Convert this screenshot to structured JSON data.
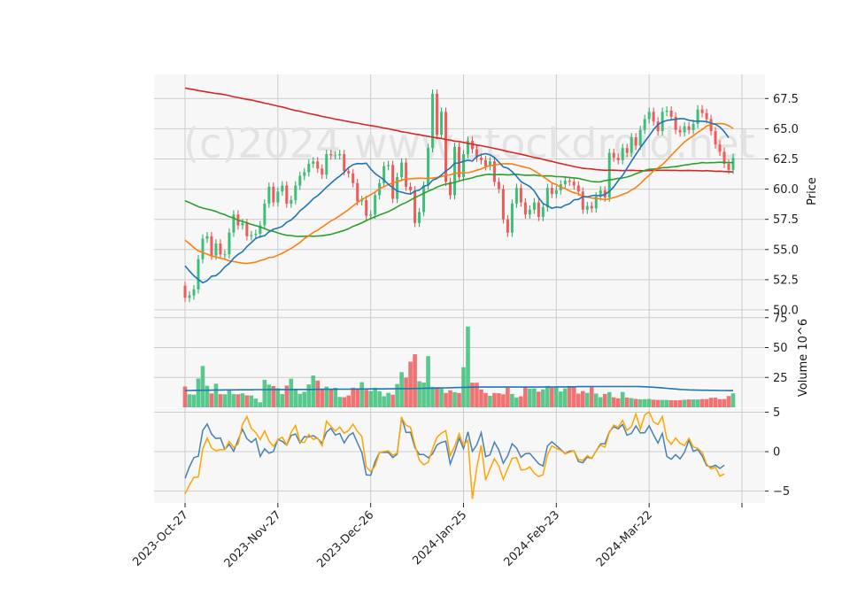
{
  "chart_data": {
    "type": "candlestick",
    "watermark": "(c)2024 www.stockdroid.net",
    "colors": {
      "up": "#26a65b",
      "down": "#e84848",
      "up_fill": "#3cbf7a",
      "down_fill": "#f05a5a",
      "ma_short": "#1f77b4",
      "ma_mid": "#ff7f0e",
      "ma_long": "#2ca02c",
      "ma_200": "#d62728",
      "vol_avg": "#1f77b4",
      "osc_1": "#4682b4",
      "osc_2": "#ffa500",
      "panel_bg": "#f7f7f7",
      "grid": "#cccccc"
    },
    "x_tick_labels": [
      "2023-Oct-27",
      "2023-Nov-27",
      "2023-Dec-26",
      "2024-Jan-25",
      "2024-Feb-23",
      "2024-Mar-22"
    ],
    "x_tick_index": [
      0,
      21,
      42,
      63,
      84,
      105
    ],
    "price_panel": {
      "ylabel": "Price",
      "ylim": [
        50.0,
        69.5
      ],
      "yticks": [
        "50.0",
        "52.5",
        "55.0",
        "57.5",
        "60.0",
        "62.5",
        "65.0",
        "67.5"
      ],
      "ytick_values": [
        50.0,
        52.5,
        55.0,
        57.5,
        60.0,
        62.5,
        65.0,
        67.5
      ],
      "close": [
        51.0,
        51.2,
        51.7,
        54.2,
        55.9,
        56.1,
        54.5,
        55.5,
        54.6,
        54.6,
        56.4,
        57.9,
        57.0,
        57.2,
        56.1,
        56.2,
        56.3,
        57.0,
        58.8,
        60.2,
        58.9,
        59.8,
        60.3,
        58.8,
        59.1,
        60.3,
        61.1,
        61.4,
        62.1,
        62.3,
        61.7,
        61.2,
        62.9,
        62.8,
        62.8,
        62.9,
        61.5,
        61.3,
        60.5,
        59.0,
        59.1,
        57.8,
        57.9,
        59.5,
        60.5,
        61.9,
        62.0,
        59.2,
        61.0,
        62.2,
        60.2,
        59.9,
        57.2,
        58.1,
        60.3,
        63.4,
        67.9,
        64.5,
        66.4,
        60.6,
        59.5,
        63.5,
        61.0,
        62.9,
        64.0,
        63.3,
        62.6,
        62.4,
        61.9,
        62.3,
        60.6,
        60.0,
        57.5,
        56.4,
        58.8,
        60.1,
        58.9,
        57.9,
        58.3,
        58.9,
        57.7,
        58.5,
        60.1,
        59.6,
        59.9,
        60.4,
        60.7,
        60.6,
        60.3,
        59.8,
        58.3,
        58.6,
        58.4,
        59.4,
        59.9,
        59.3,
        63.0,
        62.6,
        62.4,
        63.4,
        63.0,
        64.3,
        63.6,
        64.9,
        65.8,
        66.4,
        65.6,
        64.8,
        66.4,
        66.5,
        66.0,
        64.9,
        64.7,
        65.2,
        64.9,
        65.4,
        66.6,
        66.3,
        65.8,
        64.8,
        63.7,
        63.1,
        62.1,
        61.6,
        62.6
      ],
      "ma_short": [
        53.65,
        53.22,
        52.82,
        52.52,
        52.25,
        52.42,
        52.79,
        52.84,
        53.14,
        53.56,
        53.85,
        54.28,
        54.6,
        54.82,
        55.25,
        55.57,
        55.92,
        56.06,
        56.14,
        56.46,
        56.68,
        56.78,
        56.91,
        57.26,
        57.44,
        57.78,
        58.2,
        58.5,
        58.83,
        59.21,
        59.46,
        59.8,
        60.16,
        60.48,
        60.81,
        61.08,
        61.39,
        61.79,
        62.02,
        62.12,
        62.1,
        62.15,
        61.67,
        61.29,
        61.03,
        60.77,
        60.4,
        60.12,
        59.84,
        59.75,
        59.65,
        59.59,
        59.83,
        59.91,
        60.24,
        60.34,
        60.73,
        60.88,
        61.16,
        61.5,
        61.76,
        62.14,
        62.17,
        62.3,
        62.39,
        62.32,
        62.7,
        62.86,
        62.94,
        62.84,
        62.62,
        62.24,
        61.84,
        61.74,
        61.45,
        61.06,
        60.62,
        60.42,
        60.21,
        59.85,
        59.27,
        58.81,
        58.63,
        58.41,
        58.52,
        58.46,
        58.67,
        58.78,
        59.12,
        59.15,
        59.39,
        59.35,
        59.46,
        59.49,
        59.43,
        59.57,
        59.81,
        60.18,
        60.7,
        61.13,
        61.74,
        62.31,
        62.88,
        63.43,
        63.93,
        64.41,
        64.93,
        65.34,
        65.56,
        65.69,
        65.74,
        65.78,
        65.84,
        65.82,
        65.7,
        65.64,
        65.63,
        65.62,
        65.59,
        65.46,
        65.37,
        65.14,
        64.76,
        64.26
      ],
      "ma_mid": [
        55.77,
        55.49,
        55.16,
        54.89,
        54.75,
        54.62,
        54.46,
        54.39,
        54.28,
        54.2,
        54.07,
        54.0,
        53.94,
        53.87,
        53.84,
        53.9,
        53.95,
        54.09,
        54.18,
        54.34,
        54.37,
        54.53,
        54.69,
        54.89,
        55.09,
        55.34,
        55.58,
        55.91,
        56.15,
        56.41,
        56.6,
        56.86,
        57.1,
        57.37,
        57.56,
        57.8,
        58.05,
        58.31,
        58.61,
        58.9,
        59.12,
        59.35,
        59.54,
        59.76,
        60.04,
        60.2,
        60.38,
        60.51,
        60.63,
        60.75,
        60.85,
        60.86,
        60.88,
        60.91,
        60.89,
        60.88,
        60.91,
        60.97,
        61.03,
        61.16,
        61.18,
        61.31,
        61.33,
        61.35,
        61.36,
        61.44,
        61.57,
        61.66,
        61.84,
        61.96,
        61.97,
        62.06,
        62.1,
        62.11,
        62.08,
        61.99,
        61.9,
        61.8,
        61.72,
        61.52,
        61.28,
        61.03,
        60.8,
        60.52,
        60.38,
        60.16,
        60.05,
        59.85,
        59.7,
        59.61,
        59.4,
        59.37,
        59.26,
        59.23,
        59.19,
        59.12,
        59.2,
        59.3,
        59.41,
        59.57,
        59.69,
        59.93,
        60.14,
        60.46,
        60.83,
        61.15,
        61.5,
        61.75,
        62.03,
        62.4,
        62.79,
        63.17,
        63.55,
        63.91,
        64.18,
        64.43,
        64.7,
        64.93,
        65.21,
        65.36,
        65.41,
        65.43,
        65.4,
        65.25,
        65.03
      ],
      "ma_long": [
        59.04,
        58.89,
        58.72,
        58.55,
        58.43,
        58.35,
        58.26,
        58.15,
        58.0,
        57.89,
        57.71,
        57.62,
        57.42,
        57.33,
        57.21,
        57.08,
        56.98,
        56.86,
        56.74,
        56.59,
        56.5,
        56.38,
        56.27,
        56.18,
        56.16,
        56.1,
        56.09,
        56.1,
        56.12,
        56.1,
        56.12,
        56.14,
        56.2,
        56.25,
        56.36,
        56.47,
        56.58,
        56.72,
        56.92,
        57.06,
        57.21,
        57.4,
        57.57,
        57.72,
        57.86,
        58.0,
        58.14,
        58.31,
        58.53,
        58.74,
        58.89,
        59.1,
        59.3,
        59.47,
        59.65,
        59.83,
        59.98,
        60.17,
        60.31,
        60.42,
        60.47,
        60.56,
        60.67,
        60.78,
        60.85,
        60.93,
        61.06,
        61.12,
        61.2,
        61.23,
        61.19,
        61.21,
        61.2,
        61.17,
        61.2,
        61.23,
        61.19,
        61.15,
        61.15,
        61.17,
        61.11,
        61.09,
        61.1,
        61.09,
        61.03,
        61.03,
        61.0,
        60.96,
        60.93,
        60.89,
        60.8,
        60.71,
        60.63,
        60.6,
        60.61,
        60.71,
        60.76,
        60.82,
        60.89,
        60.92,
        61.0,
        61.11,
        61.28,
        61.41,
        61.55,
        61.64,
        61.66,
        61.71,
        61.77,
        61.79,
        61.83,
        61.86,
        61.93,
        61.99,
        62.04,
        62.1,
        62.13,
        62.2,
        62.17,
        62.19,
        62.2,
        62.23,
        62.21,
        62.19,
        62.2
      ],
      "ma_200": [
        68.37,
        68.3,
        68.24,
        68.16,
        68.1,
        68.04,
        67.98,
        67.92,
        67.88,
        67.82,
        67.74,
        67.64,
        67.59,
        67.5,
        67.43,
        67.38,
        67.29,
        67.21,
        67.12,
        67.05,
        66.96,
        66.87,
        66.8,
        66.7,
        66.6,
        66.51,
        66.45,
        66.35,
        66.27,
        66.19,
        66.11,
        66.02,
        65.95,
        65.88,
        65.79,
        65.73,
        65.66,
        65.59,
        65.52,
        65.47,
        65.39,
        65.32,
        65.26,
        65.2,
        65.14,
        65.06,
        65.0,
        64.91,
        64.85,
        64.75,
        64.7,
        64.63,
        64.56,
        64.51,
        64.43,
        64.37,
        64.3,
        64.24,
        64.2,
        64.11,
        64.06,
        63.97,
        63.94,
        63.87,
        63.79,
        63.74,
        63.65,
        63.6,
        63.52,
        63.45,
        63.37,
        63.3,
        63.21,
        63.11,
        63.04,
        62.97,
        62.89,
        62.81,
        62.71,
        62.62,
        62.55,
        62.46,
        62.37,
        62.3,
        62.2,
        62.12,
        62.03,
        61.96,
        61.87,
        61.8,
        61.72,
        61.69,
        61.67,
        61.61,
        61.59,
        61.56,
        61.57,
        61.57,
        61.55,
        61.53,
        61.55,
        61.56,
        61.54,
        61.53,
        61.52,
        61.54,
        61.54,
        61.56,
        61.56,
        61.56,
        61.55,
        61.55,
        61.53,
        61.54,
        61.55,
        61.53,
        61.53,
        61.5,
        61.53,
        61.5,
        61.48,
        61.49,
        61.46,
        61.44,
        61.42
      ]
    },
    "volume_panel": {
      "ylabel": "Volume  10^6",
      "ylim": [
        0,
        80
      ],
      "yticks": [
        "25",
        "50",
        "75"
      ],
      "ytick_values": [
        25,
        50,
        75
      ],
      "volume": [
        17.4,
        10.9,
        10.6,
        24.1,
        34.6,
        18.0,
        11.6,
        19.8,
        11.0,
        10.9,
        14.7,
        11.0,
        10.9,
        11.7,
        10.0,
        9.9,
        7.3,
        4.2,
        23.0,
        19.0,
        17.8,
        16.0,
        11.1,
        18.2,
        24.0,
        14.6,
        11.3,
        13.0,
        19.2,
        26.6,
        22.4,
        15.6,
        17.3,
        15.0,
        16.3,
        8.7,
        8.5,
        9.9,
        16.4,
        14.8,
        21.1,
        14.6,
        13.7,
        16.4,
        13.5,
        9.3,
        12.1,
        10.5,
        19.5,
        29.4,
        24.8,
        38.2,
        44.4,
        21.8,
        20.7,
        42.8,
        17.2,
        16.9,
        15.6,
        12.0,
        14.3,
        12.7,
        11.9,
        33.5,
        67.6,
        20.6,
        20.6,
        15.0,
        12.0,
        9.7,
        12.0,
        11.8,
        10.9,
        16.4,
        11.2,
        8.3,
        9.2,
        16.7,
        15.6,
        15.8,
        13.1,
        15.1,
        17.9,
        16.3,
        16.5,
        13.2,
        15.8,
        17.8,
        16.7,
        11.5,
        13.6,
        12.1,
        16.9,
        11.5,
        8.5,
        11.2,
        12.7,
        8.4,
        7.5,
        12.8,
        8.2,
        7.7,
        7.0,
        6.7,
        6.8,
        7.0,
        6.4,
        6.2,
        6.2,
        6.2,
        6.0,
        5.9,
        6.0,
        6.4,
        6.6,
        6.6,
        6.6,
        6.9,
        6.9,
        8.0,
        8.1,
        6.8,
        6.9,
        9.4,
        11.7
      ],
      "vol_avg": [
        14.0,
        14.1,
        14.2,
        14.2,
        14.3,
        14.3,
        14.4,
        14.5,
        14.5,
        14.6,
        14.6,
        14.6,
        14.7,
        14.7,
        14.7,
        14.7,
        14.8,
        14.8,
        14.8,
        14.8,
        14.9,
        14.9,
        14.9,
        14.9,
        14.9,
        15.0,
        15.0,
        15.0,
        15.0,
        15.0,
        15.1,
        15.1,
        15.1,
        15.1,
        15.1,
        15.2,
        15.2,
        15.2,
        15.2,
        15.3,
        15.3,
        15.3,
        15.4,
        15.4,
        15.4,
        15.4,
        15.5,
        15.5,
        15.6,
        15.6,
        15.6,
        15.7,
        15.8,
        15.8,
        15.9,
        16.0,
        16.0,
        16.1,
        16.2,
        16.3,
        16.4,
        16.5,
        16.6,
        16.7,
        16.8,
        16.9,
        16.9,
        17.0,
        17.0,
        17.0,
        17.0,
        17.0,
        17.0,
        17.0,
        17.0,
        17.0,
        17.0,
        17.0,
        17.0,
        17.0,
        17.0,
        17.0,
        17.0,
        17.0,
        17.1,
        17.1,
        17.1,
        17.2,
        17.2,
        17.3,
        17.3,
        17.3,
        17.4,
        17.4,
        17.4,
        17.4,
        17.4,
        17.4,
        17.4,
        17.4,
        17.4,
        17.4,
        17.4,
        17.3,
        17.2,
        17.0,
        16.8,
        16.5,
        16.2,
        15.9,
        15.6,
        15.3,
        15.0,
        14.8,
        14.6,
        14.5,
        14.4,
        14.3,
        14.3,
        14.2,
        14.2,
        14.1,
        14.1,
        14.0,
        14.0
      ]
    },
    "oscillator_panel": {
      "ylim": [
        -6.5,
        5.5
      ],
      "yticks": [
        "−5",
        "0",
        "5"
      ],
      "ytick_values": [
        -5,
        0,
        5
      ],
      "line1": [
        -3.38,
        -1.91,
        -0.75,
        -0.58,
        2.68,
        3.5,
        2.21,
        1.67,
        1.73,
        0.28,
        0.94,
        0.05,
        1.49,
        2.84,
        1.64,
        1.17,
        1.66,
        -0.6,
        0.36,
        -0.21,
        0.02,
        1.56,
        1.3,
        0.82,
        2.05,
        2.25,
        1.11,
        1.91,
        1.86,
        2.04,
        1.66,
        1.07,
        2.46,
        2.97,
        2.11,
        2.31,
        1.1,
        2.0,
        2.41,
        1.1,
        -0.12,
        -2.94,
        -2.99,
        -1.24,
        -0.1,
        -0.1,
        -0.08,
        -0.75,
        -0.31,
        4.34,
        2.43,
        2.46,
        0.5,
        -0.35,
        -0.35,
        -0.77,
        -0.28,
        0.85,
        1.17,
        1.33,
        -1.55,
        -0.05,
        1.71,
        0.39,
        2.51,
        0.04,
        0.86,
        2.4,
        -0.63,
        -0.4,
        1.21,
        0.21,
        -1.46,
        -0.52,
        0.99,
        0.47,
        -0.71,
        -0.26,
        -0.22,
        -0.88,
        -1.53,
        -1.82,
        0.72,
        1.25,
        0.77,
        0.29,
        -0.26,
        0.06,
        0.09,
        -1.25,
        -1.4,
        -0.69,
        -0.85,
        0.08,
        0.98,
        1.01,
        2.5,
        3.16,
        2.9,
        3.44,
        2.09,
        2.32,
        3.26,
        2.36,
        2.4,
        3.28,
        2.13,
        1.08,
        2.33,
        -0.6,
        -0.97,
        -0.38,
        -0.92,
        -0.07,
        1.45,
        0.04,
        0.27,
        -0.55,
        -1.76,
        -1.95,
        -1.72,
        -2.13,
        -1.71
      ],
      "line2": [
        -5.37,
        -4.22,
        -3.26,
        -3.23,
        0.35,
        1.72,
        0.47,
        0.11,
        0.25,
        0.25,
        1.31,
        0.52,
        0.94,
        3.46,
        4.43,
        2.94,
        2.41,
        1.52,
        2.63,
        1.36,
        0.68,
        1.53,
        1.83,
        0.87,
        2.43,
        3.32,
        1.26,
        1.16,
        2.18,
        1.55,
        1.71,
        0.73,
        3.84,
        3.21,
        2.61,
        3.11,
        2.34,
        2.67,
        3.48,
        2.56,
        1.91,
        -1.91,
        -2.54,
        -1.81,
        -0.1,
        0.02,
        0.12,
        -0.46,
        -0.18,
        4.29,
        3.34,
        3.1,
        0.82,
        -1.07,
        -1.65,
        -1.34,
        0.35,
        1.82,
        2.34,
        2.65,
        -0.52,
        0.68,
        2.27,
        0.8,
        1.44,
        -5.97,
        -2.04,
        0.8,
        -3.6,
        -2.21,
        -0.89,
        -1.82,
        -3.51,
        -2.18,
        -0.86,
        -0.75,
        -2.33,
        -2.26,
        -1.94,
        -2.73,
        -3.16,
        -2.92,
        -0.39,
        0.75,
        0.41,
        0.18,
        -0.28,
        -0.09,
        0.11,
        -1.01,
        -1.1,
        -0.51,
        -0.84,
        0.07,
        0.82,
        0.56,
        2.39,
        3.37,
        3.05,
        3.96,
        2.7,
        3.18,
        4.79,
        2.85,
        4.66,
        5.03,
        3.77,
        3.44,
        4.46,
        1.64,
        0.94,
        1.73,
        1.06,
        0.78,
        1.7,
        0.59,
        0.41,
        -0.12,
        -1.55,
        -2.21,
        -1.96,
        -3.1,
        -2.83
      ]
    }
  }
}
